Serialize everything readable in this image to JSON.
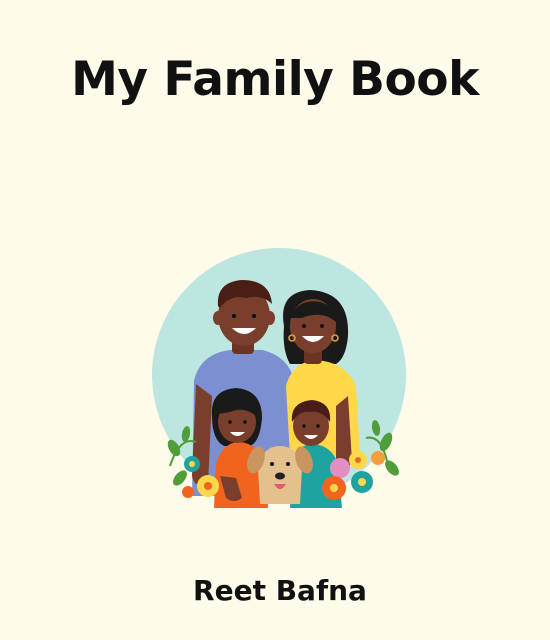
{
  "book": {
    "title": "My Family Book",
    "author": "Reet Bafna"
  },
  "illustration": {
    "icon": "family-portrait-icon"
  },
  "colors": {
    "page_background": "#fffbea",
    "circle": "#bde6e0",
    "skin": "#7a3f2c",
    "hair": "#1a1a1a",
    "dad_shirt": "#7b8fd1",
    "mom_shirt": "#ffd84a",
    "girl_shirt": "#f0641e",
    "boy_shirt": "#1fa3a0",
    "dog": "#e4c08c",
    "leaves": "#4f9e3a"
  }
}
